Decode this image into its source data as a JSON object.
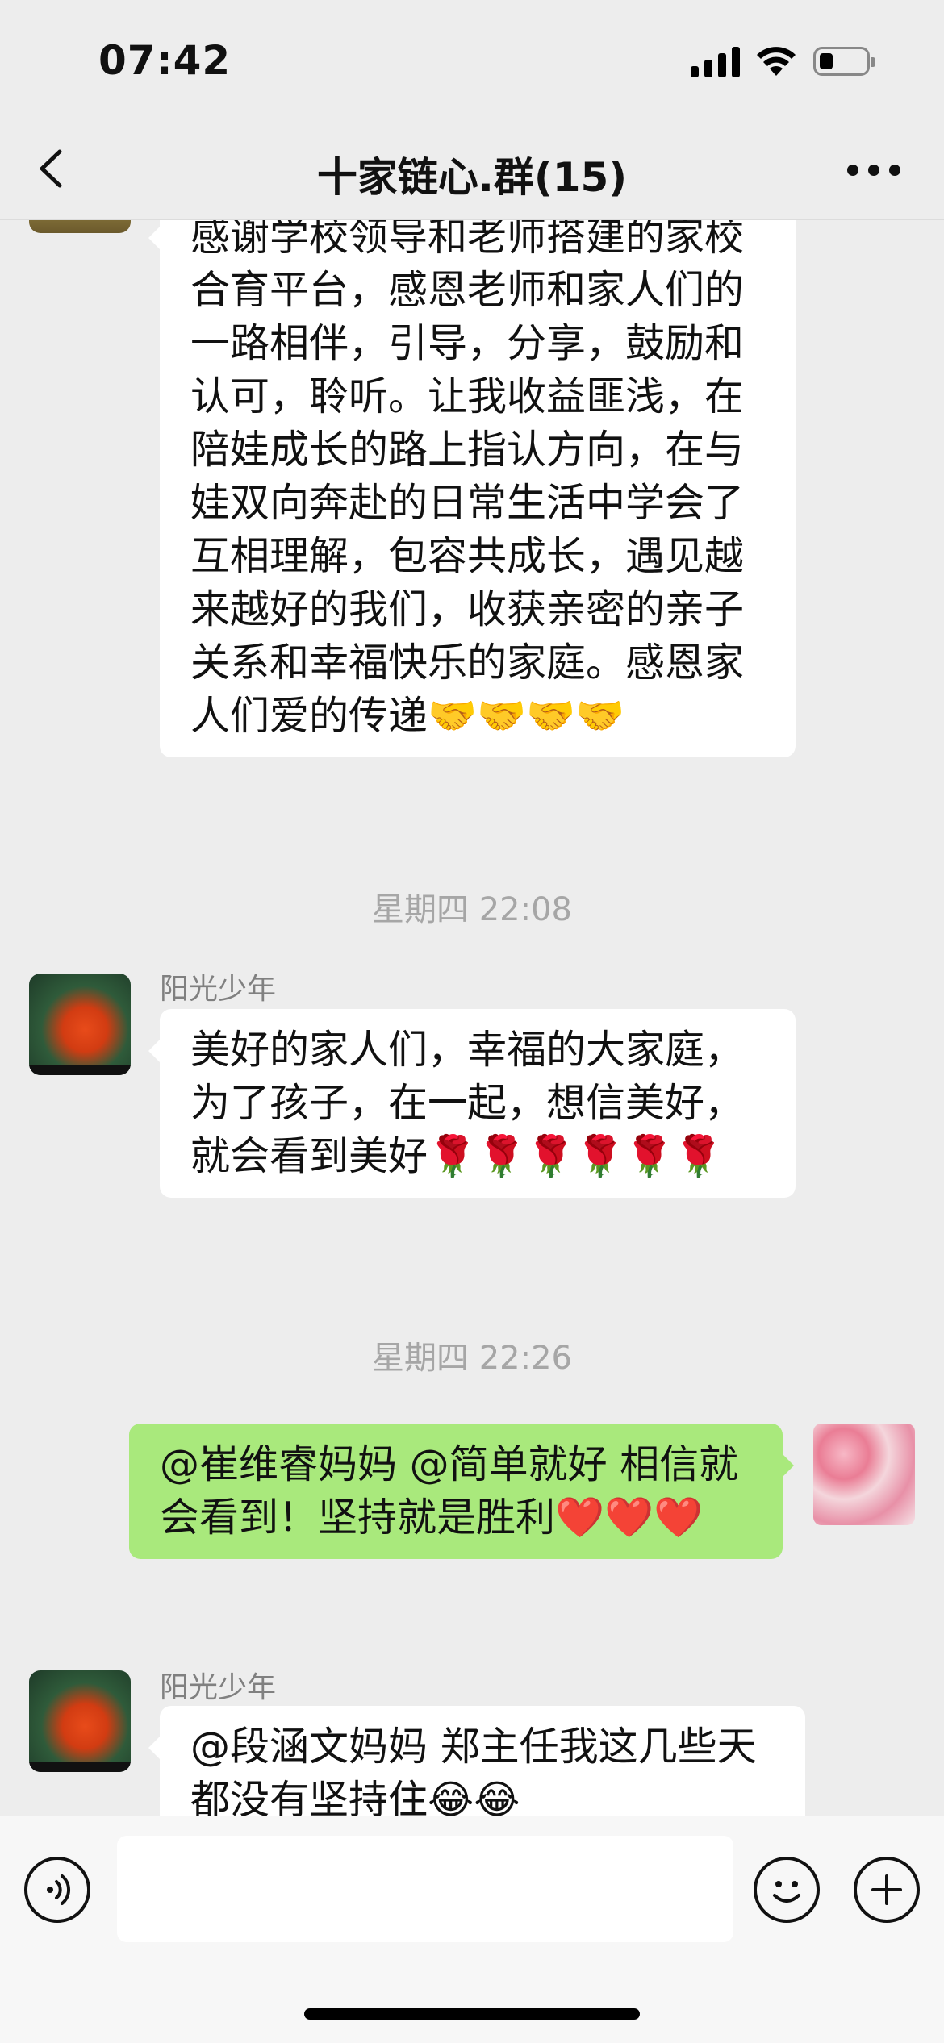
{
  "status_bar": {
    "time": "07:42",
    "icons": [
      "signal-icon",
      "wifi-icon",
      "battery-icon"
    ]
  },
  "nav": {
    "title": "十家链心.群(15)",
    "back_icon": "chevron-left-icon",
    "more_icon": "more-horizontal-icon"
  },
  "messages": [
    {
      "type": "incoming",
      "avatar": "wheat-field",
      "text": "感谢学校领导和老师搭建的家校合育平台，感恩老师和家人们的一路相伴，引导，分享，鼓励和认可，聆听。让我收益匪浅，在陪娃成长的路上指认方向，在与娃双向奔赴的日常生活中学会了互相理解，包容共成长，遇见越来越好的我们，收获亲密的亲子关系和幸福快乐的家庭。感恩家人们爱的传递🤝🤝🤝🤝"
    },
    {
      "type": "timestamp",
      "text": "星期四 22:08"
    },
    {
      "type": "incoming",
      "sender": "阳光少年",
      "avatar": "goldfish",
      "text": "美好的家人们，幸福的大家庭，为了孩子，在一起，想信美好，就会看到美好🌹🌹🌹🌹🌹🌹"
    },
    {
      "type": "timestamp",
      "text": "星期四 22:26"
    },
    {
      "type": "outgoing",
      "avatar": "pink-flowers",
      "text": "@崔维睿妈妈 @简单就好 相信就会看到！坚持就是胜利❤️❤️❤️"
    },
    {
      "type": "incoming",
      "sender": "阳光少年",
      "avatar": "goldfish",
      "text": "@段涵文妈妈 郑主任我这几些天都没有坚持住😂😂"
    }
  ],
  "input_bar": {
    "voice_icon": "voice-icon",
    "emoji_icon": "emoji-icon",
    "plus_icon": "plus-icon",
    "placeholder": ""
  },
  "colors": {
    "background": "#ededed",
    "outgoing_bubble": "#a9e97c",
    "incoming_bubble": "#ffffff",
    "timestamp": "#a6a6a6",
    "sender": "#808080"
  }
}
